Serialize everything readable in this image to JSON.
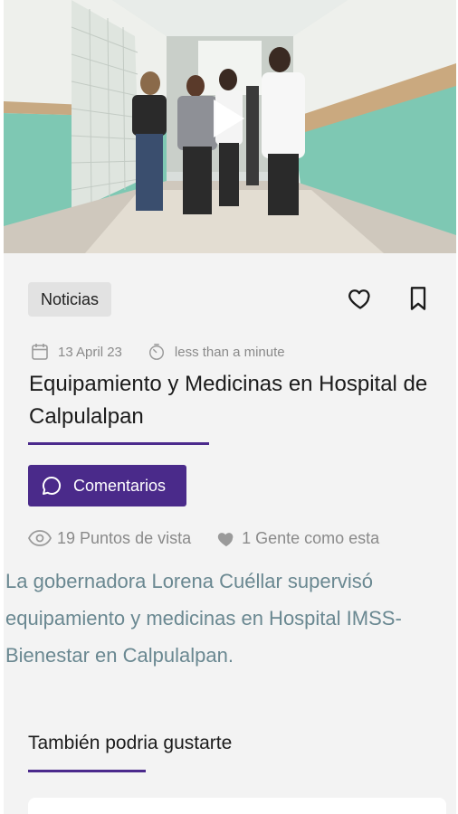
{
  "article": {
    "category": "Noticias",
    "date": "13 April 23",
    "read_time": "less than a minute",
    "title": "Equipamiento y Medicinas en Hospital de Calpulalpan",
    "comments_label": "Comentarios",
    "views": "19 Puntos de vista",
    "likes": "1 Gente como esta",
    "summary": "La gobernadora Lorena Cuéllar supervisó equipamiento y medicinas en Hospital IMSS-Bienestar en Calpulalpan."
  },
  "related": {
    "title": "También podria gustarte"
  },
  "icons": {
    "play": "play-icon",
    "favorite": "heart-outline-icon",
    "bookmark": "bookmark-icon",
    "date": "calendar-icon",
    "time": "timer-icon",
    "comments": "chat-bubble-icon",
    "views": "eye-icon",
    "likes": "heart-filled-icon"
  },
  "colors": {
    "accent": "#4a2a8a",
    "summary_text": "#6a8891",
    "muted_text": "#8a8a8a"
  }
}
